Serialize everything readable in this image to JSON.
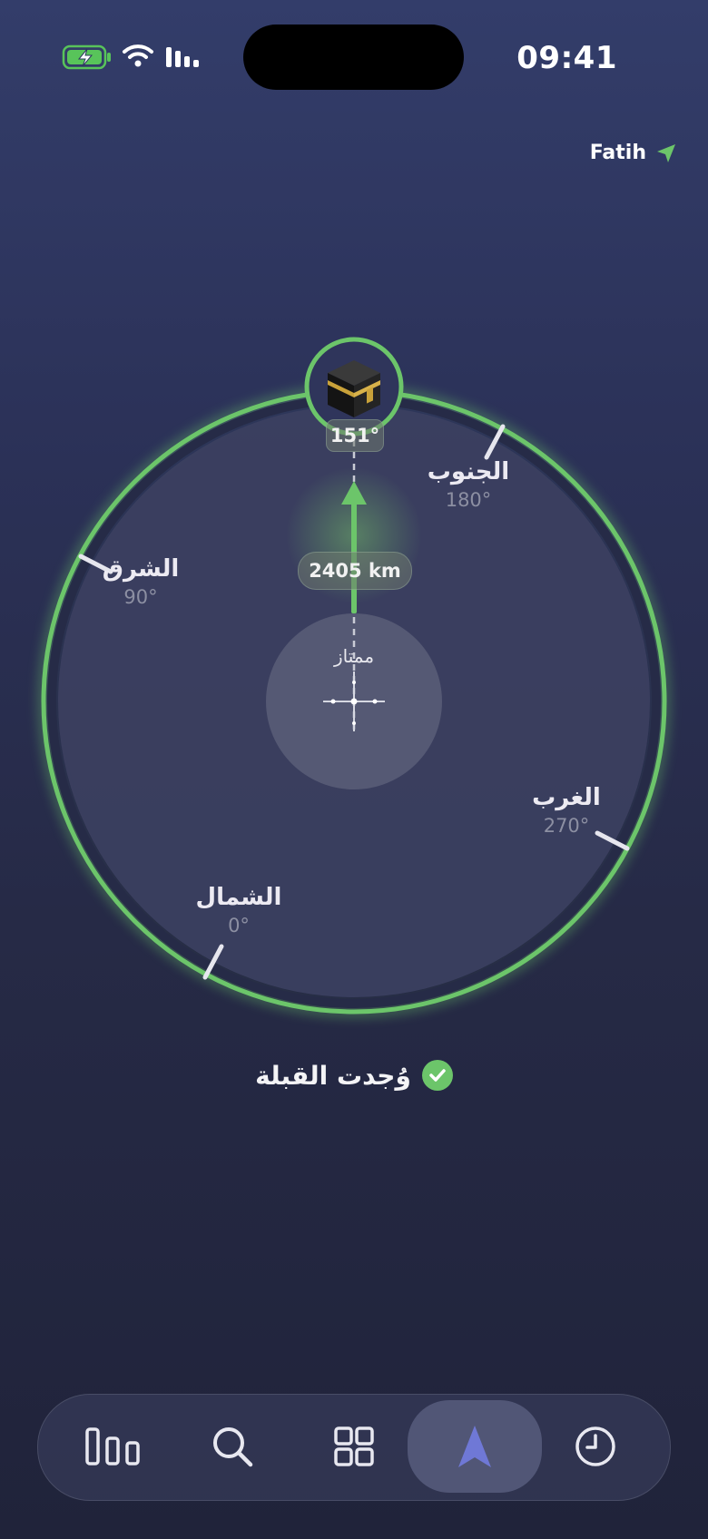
{
  "status_bar": {
    "time": "09:41"
  },
  "location": {
    "name": "Fatih"
  },
  "compass": {
    "qibla_bearing": "151°",
    "distance": "2405 km",
    "accuracy": "ممتاز",
    "directions": [
      {
        "name": "الجنوب",
        "degree": "180°"
      },
      {
        "name": "الشرق",
        "degree": "90°"
      },
      {
        "name": "الغرب",
        "degree": "270°"
      },
      {
        "name": "الشمال",
        "degree": "0°"
      }
    ]
  },
  "status_message": "وُجدت القبلة",
  "tabs": [
    {
      "icon": "stats-bars-icon"
    },
    {
      "icon": "search-icon"
    },
    {
      "icon": "grid-icon"
    },
    {
      "icon": "qibla-arrow-icon",
      "active": true
    },
    {
      "icon": "clock-icon"
    }
  ],
  "colors": {
    "accent_green": "#6cc56a",
    "active_tab_icon": "#6f78d6"
  }
}
